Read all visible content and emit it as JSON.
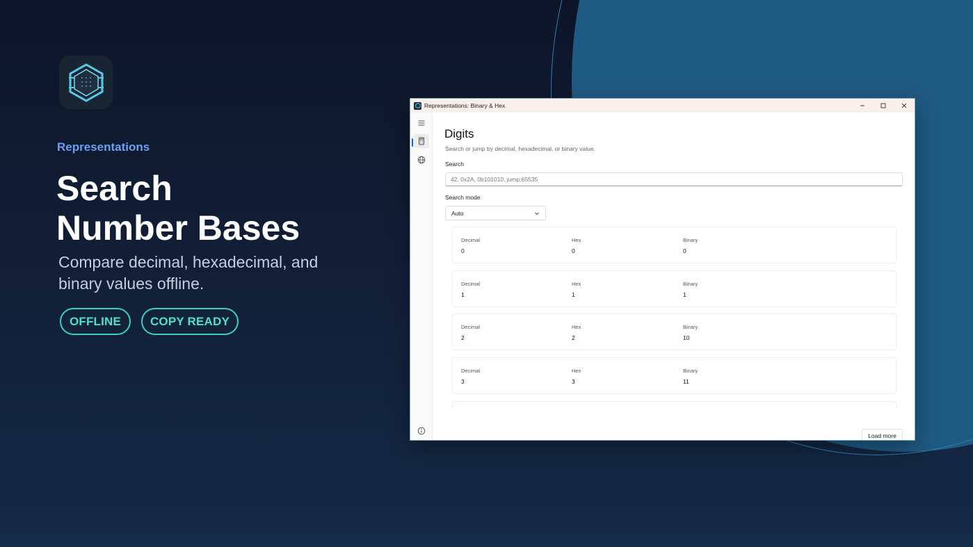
{
  "hero": {
    "app_name": "Representations",
    "title_line1": "Search",
    "title_line2": "Number Bases",
    "subtitle": "Compare decimal, hexadecimal, and binary values offline.",
    "badges": [
      "OFFLINE",
      "COPY READY"
    ]
  },
  "window": {
    "title": "Representations: Binary & Hex",
    "page_title": "Digits",
    "page_description": "Search or jump by decimal, hexadecimal, or binary value.",
    "search_label": "Search",
    "search_placeholder": "42, 0x2A, 0b101010, jump:65535",
    "mode_label": "Search mode",
    "mode_value": "Auto",
    "field_labels": {
      "decimal": "Decimal",
      "hex": "Hex",
      "binary": "Binary"
    },
    "rows": [
      {
        "decimal": "0",
        "hex": "0",
        "binary": "0"
      },
      {
        "decimal": "1",
        "hex": "1",
        "binary": "1"
      },
      {
        "decimal": "2",
        "hex": "2",
        "binary": "10"
      },
      {
        "decimal": "3",
        "hex": "3",
        "binary": "11"
      }
    ],
    "load_more_label": "Load more"
  },
  "icons": {
    "app": "hexagon-grid-icon",
    "nav": [
      "hamburger-menu-icon",
      "calculator-icon",
      "globe-icon"
    ],
    "footer": "info-icon",
    "window_controls": [
      "minimize-icon",
      "maximize-icon",
      "close-icon"
    ]
  },
  "colors": {
    "accent_blue": "#6d9ef2",
    "badge_teal": "#3ecfc0",
    "nav_indicator": "#1a5fd0"
  }
}
